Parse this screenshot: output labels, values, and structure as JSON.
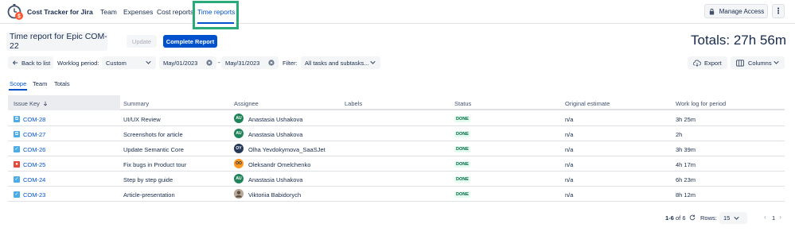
{
  "nav": {
    "app_name": "Cost Tracker for Jira",
    "links": [
      "Team",
      "Expenses",
      "Cost reports",
      "Time reports"
    ],
    "manage_access": "Manage Access",
    "more": "⋮"
  },
  "header": {
    "title": "Time report for Epic COM-22",
    "update_label": "Update",
    "complete_label": "Complete Report",
    "totals": "Totals: 27h 56m"
  },
  "filters": {
    "back_label": "Back to list",
    "worklog_label": "Worklog period:",
    "period_value": "Custom",
    "date_from": "May/01/2023",
    "date_separator": "-",
    "date_to": "May/31/2023",
    "filter_label": "Filter:",
    "filter_value": "All tasks and subtasks...",
    "export_label": "Export",
    "columns_label": "Columns"
  },
  "tabs": [
    "Scope",
    "Team",
    "Totals"
  ],
  "table": {
    "columns": [
      "Issue Key",
      "Summary",
      "Assignee",
      "Labels",
      "Status",
      "Original estimate",
      "Work log for period"
    ],
    "rows": [
      {
        "type": "subtask",
        "key": "COM-28",
        "summary": "UI/UX Review",
        "assignee": "Anastasia Ushakova",
        "initials": "AU",
        "avatar_color": "#1f845a",
        "labels": "",
        "status": "DONE",
        "estimate": "n/a",
        "worklog": "3h 25m"
      },
      {
        "type": "subtask",
        "key": "COM-27",
        "summary": "Screenshots for article",
        "assignee": "Anastasia Ushakova",
        "initials": "AU",
        "avatar_color": "#1f845a",
        "labels": "",
        "status": "DONE",
        "estimate": "n/a",
        "worklog": "2h"
      },
      {
        "type": "task",
        "key": "COM-26",
        "summary": "Update Semantic Core",
        "assignee": "Olha Yevdokymova_SaaSJet",
        "initials": "OY",
        "avatar_color": "#253858",
        "labels": "",
        "status": "DONE",
        "estimate": "n/a",
        "worklog": "3h 39m"
      },
      {
        "type": "bug",
        "key": "COM-25",
        "summary": "Fix bugs in Product tour",
        "assignee": "Oleksandr Omelchenko",
        "initials": "OO",
        "avatar_color": "#ff991f",
        "labels": "",
        "status": "DONE",
        "estimate": "n/a",
        "worklog": "4h 17m"
      },
      {
        "type": "task",
        "key": "COM-24",
        "summary": "Step by step guide",
        "assignee": "Anastasia Ushakova",
        "initials": "AU",
        "avatar_color": "#1f845a",
        "labels": "",
        "status": "DONE",
        "estimate": "n/a",
        "worklog": "6h 23m"
      },
      {
        "type": "task",
        "key": "COM-23",
        "summary": "Article-presentation",
        "assignee": "Viktoriia Babidorych",
        "initials": "",
        "avatar_color": "#8f7f6e",
        "labels": "",
        "status": "DONE",
        "estimate": "n/a",
        "worklog": "8h 12m"
      }
    ]
  },
  "footer": {
    "range_bold": "1-6",
    "range_rest": "of 6",
    "rows_label": "Rows:",
    "rows_value": "15",
    "page": "1",
    "prev": "‹",
    "next": "›"
  },
  "colors": {
    "primary": "#0052cc",
    "highlight_frame": "#2aa979",
    "done_text": "#006644",
    "done_bg": "#e3fcef",
    "subtask": "#4bade8",
    "task": "#4bade8",
    "bug": "#e5493a"
  },
  "icons": {
    "back": "arrow-left-icon",
    "export": "cloud-download-icon",
    "columns": "columns-icon",
    "lock": "lock-icon",
    "refresh": "refresh-icon",
    "sort": "arrow-down-icon"
  }
}
